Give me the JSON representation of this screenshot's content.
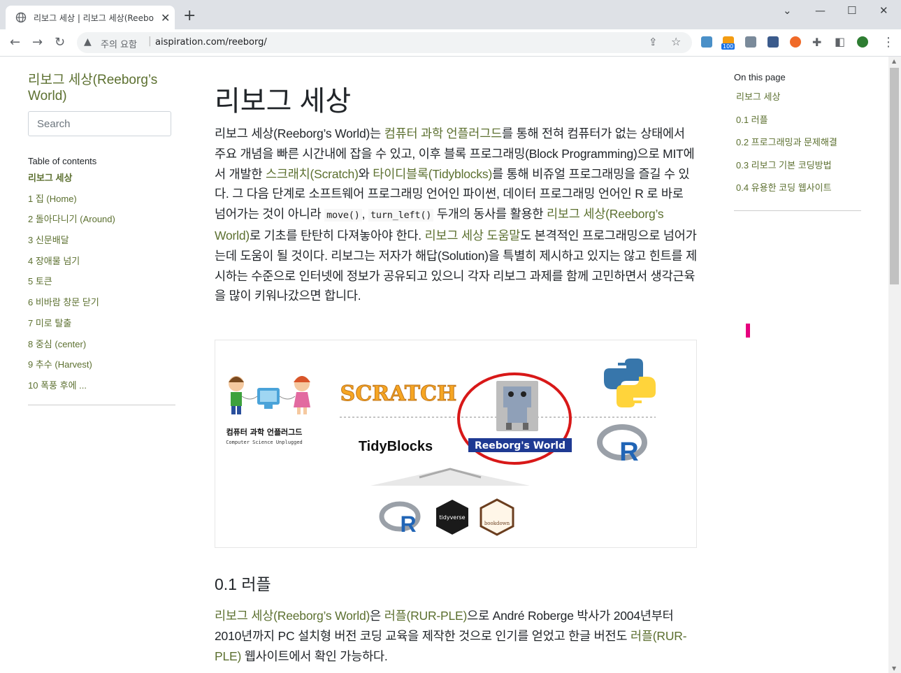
{
  "browser": {
    "tab_title": "리보그 세상 | 리보그 세상(Reebo",
    "security_label": "주의 요함",
    "url": "aispiration.com/reeborg/",
    "extension_badge": "100"
  },
  "sidebar": {
    "brand": "리보그 세상(Reeborg’s World)",
    "search_placeholder": "Search",
    "toc_title": "Table of contents",
    "items": [
      {
        "label": "리보그 세상"
      },
      {
        "label": "1 집 (Home)"
      },
      {
        "label": "2 돌아다니기 (Around)"
      },
      {
        "label": "3 신문배달"
      },
      {
        "label": "4 장애물 넘기"
      },
      {
        "label": "5 토큰"
      },
      {
        "label": "6 비바람 창문 닫기"
      },
      {
        "label": "7 미로 탈출"
      },
      {
        "label": "8 중심 (center)"
      },
      {
        "label": "9 추수 (Harvest)"
      },
      {
        "label": "10 폭풍 후에 ..."
      }
    ]
  },
  "main": {
    "title": "리보그 세상",
    "p1": {
      "t1": "리보그 세상(Reeborg’s World)는 ",
      "l1": "컴퓨터 과학 언플러그드",
      "t2": "를 통해 전혀 컴퓨터가 없는 상태에서 주요 개념을 빠른 시간내에 잡을 수 있고, 이후 블록 프로그래밍(Block Programming)으로 MIT에서 개발한 ",
      "l2": "스크래치(Scratch)",
      "t3": "와 ",
      "l3": "타이디블록(Tidyblocks)",
      "t4": "를 통해 비쥬얼 프로그래밍을 즐길 수 있다. 그 다음 단계로 소프트웨어 프로그래밍 언어인 파이썬, 데이터 프로그래밍 언어인 R 로 바로 넘어가는 것이 아니라 ",
      "c1": "move()",
      "t5": ", ",
      "c2": "turn_left()",
      "t6": " 두개의 동사를 활용한 ",
      "l4": "리보그 세상(Reeborg’s World)",
      "t7": "로 기초를 탄탄히 다져놓아야 한다. ",
      "l5": "리보그 세상 도움말",
      "t8": "도 본격적인 프로그래밍으로 넘어가는데 도움이 될 것이다. 리보그는 저자가 해답(Solution)을 특별히 제시하고 있지는 않고 힌트를 제시하는 수준으로 인터넷에 정보가 공유되고 있으니 각자 리보그 과제를 함께 고민하면서 생각근육을 많이 키워나갔으면 합니다."
    },
    "figure": {
      "unplugged_title": "컴퓨터 과학 언플러그드",
      "unplugged_sub": "Computer Science Unplugged",
      "scratch": "SCRATCH",
      "tidyblocks": "TidyBlocks",
      "reeborg": "Reeborg's World",
      "r_logo": "R",
      "tidyverse": "tidyverse",
      "bookdown": "bookdown"
    },
    "section_title": "0.1 러플",
    "p2": {
      "l1": "리보그 세상(Reeborg’s World)",
      "t1": "은 ",
      "l2": "러플(RUR-PLE)",
      "t2": "으로 André Roberge 박사가 2004년부터 2010년까지 PC 설치형 버전 코딩 교육을 제작한 것으로 인기를 얻었고 한글 버전도 ",
      "l3": "러플(RUR-PLE)",
      "t3": " 웹사이트에서 확인 가능하다."
    }
  },
  "right": {
    "title": "On this page",
    "items": [
      {
        "label": "리보그 세상"
      },
      {
        "label": "0.1 러플"
      },
      {
        "label": "0.2 프로그래밍과 문제해결"
      },
      {
        "label": "0.3 리보그 기본 코딩방법"
      },
      {
        "label": "0.4 유용한 코딩 웹사이트"
      }
    ]
  }
}
